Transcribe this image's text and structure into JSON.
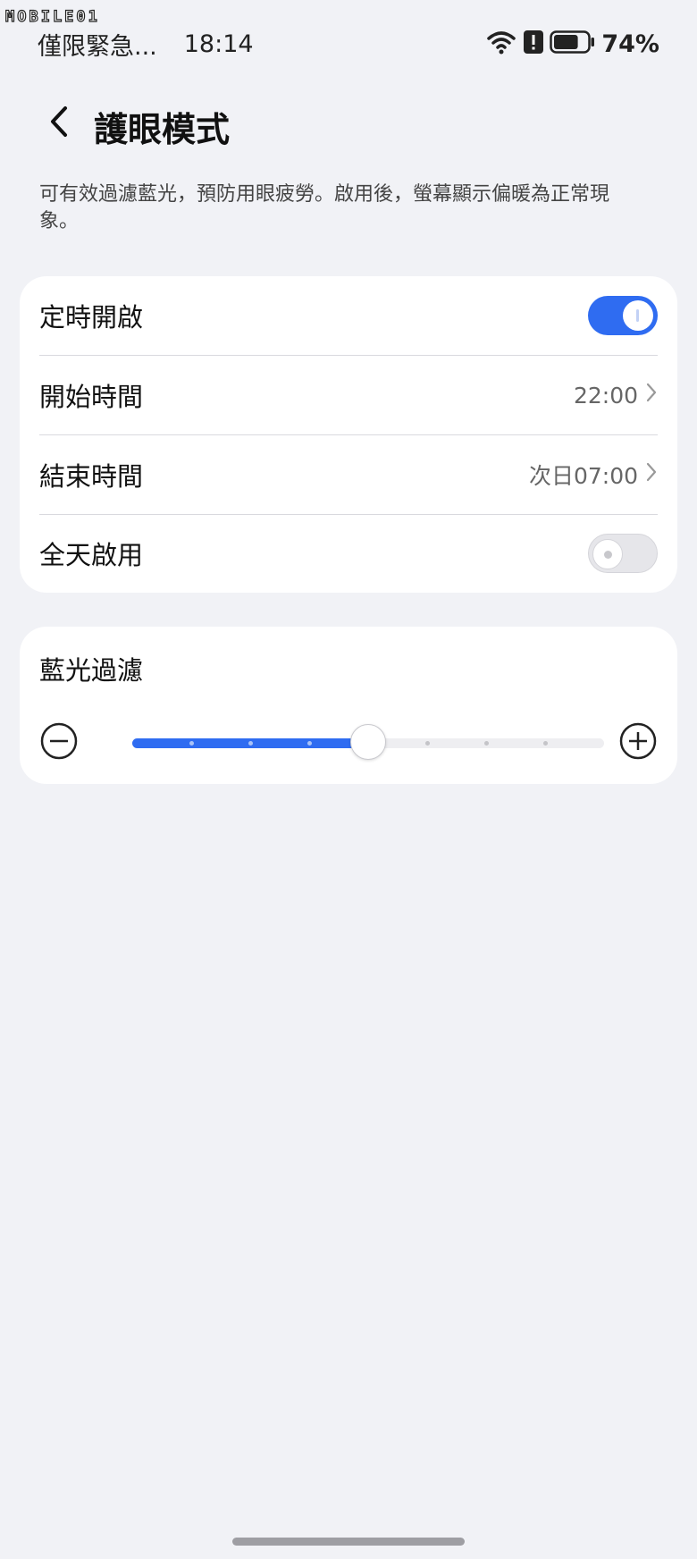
{
  "watermark": {
    "text": "MOBILE01"
  },
  "status_bar": {
    "carrier": "僅限緊急...",
    "time": "18:14",
    "battery": "74%",
    "battery_level": 0.74,
    "icons": [
      "wifi-icon",
      "alert-icon",
      "battery-icon"
    ]
  },
  "header": {
    "title": "護眼模式",
    "back_icon": "chevron-left-icon"
  },
  "description": "可有效過濾藍光，預防用眼疲勞。啟用後，螢幕顯示偏暖為正常現象。",
  "schedule_card": {
    "scheduled": {
      "label": "定時開啟",
      "enabled": true
    },
    "start_time": {
      "label": "開始時間",
      "value": "22:00"
    },
    "end_time": {
      "label": "結束時間",
      "value": "次日07:00"
    },
    "all_day": {
      "label": "全天啟用",
      "enabled": false
    }
  },
  "filter_card": {
    "title": "藍光過濾",
    "level": 0.5,
    "steps": 8,
    "minus_icon": "minus-circle-icon",
    "plus_icon": "plus-circle-icon"
  },
  "colors": {
    "accent": "#2f6cf1",
    "background": "#f1f2f6",
    "card": "#ffffff"
  }
}
